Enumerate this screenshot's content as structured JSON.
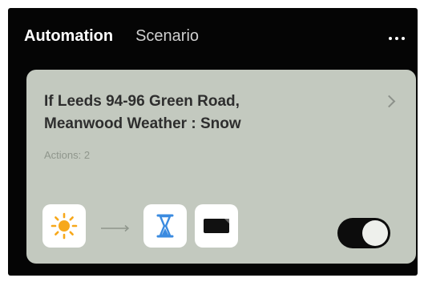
{
  "header": {
    "tabs": [
      {
        "label": "Automation",
        "active": true
      },
      {
        "label": "Scenario",
        "active": false
      }
    ],
    "more_icon": "more-dots-icon"
  },
  "automation_card": {
    "title": "If Leeds 94-96 Green Road,\nMeanwood Weather : Snow",
    "actions_text": "Actions: 2",
    "condition_icon": "sun-icon",
    "action_icons": [
      "hourglass-icon",
      "screen-icon"
    ],
    "enabled": true
  },
  "colors": {
    "background": "#050505",
    "card": "#c3c9bf",
    "sun": "#f7a81b",
    "hourglass": "#3b8be0",
    "toggle_track": "#0c0c0c"
  }
}
